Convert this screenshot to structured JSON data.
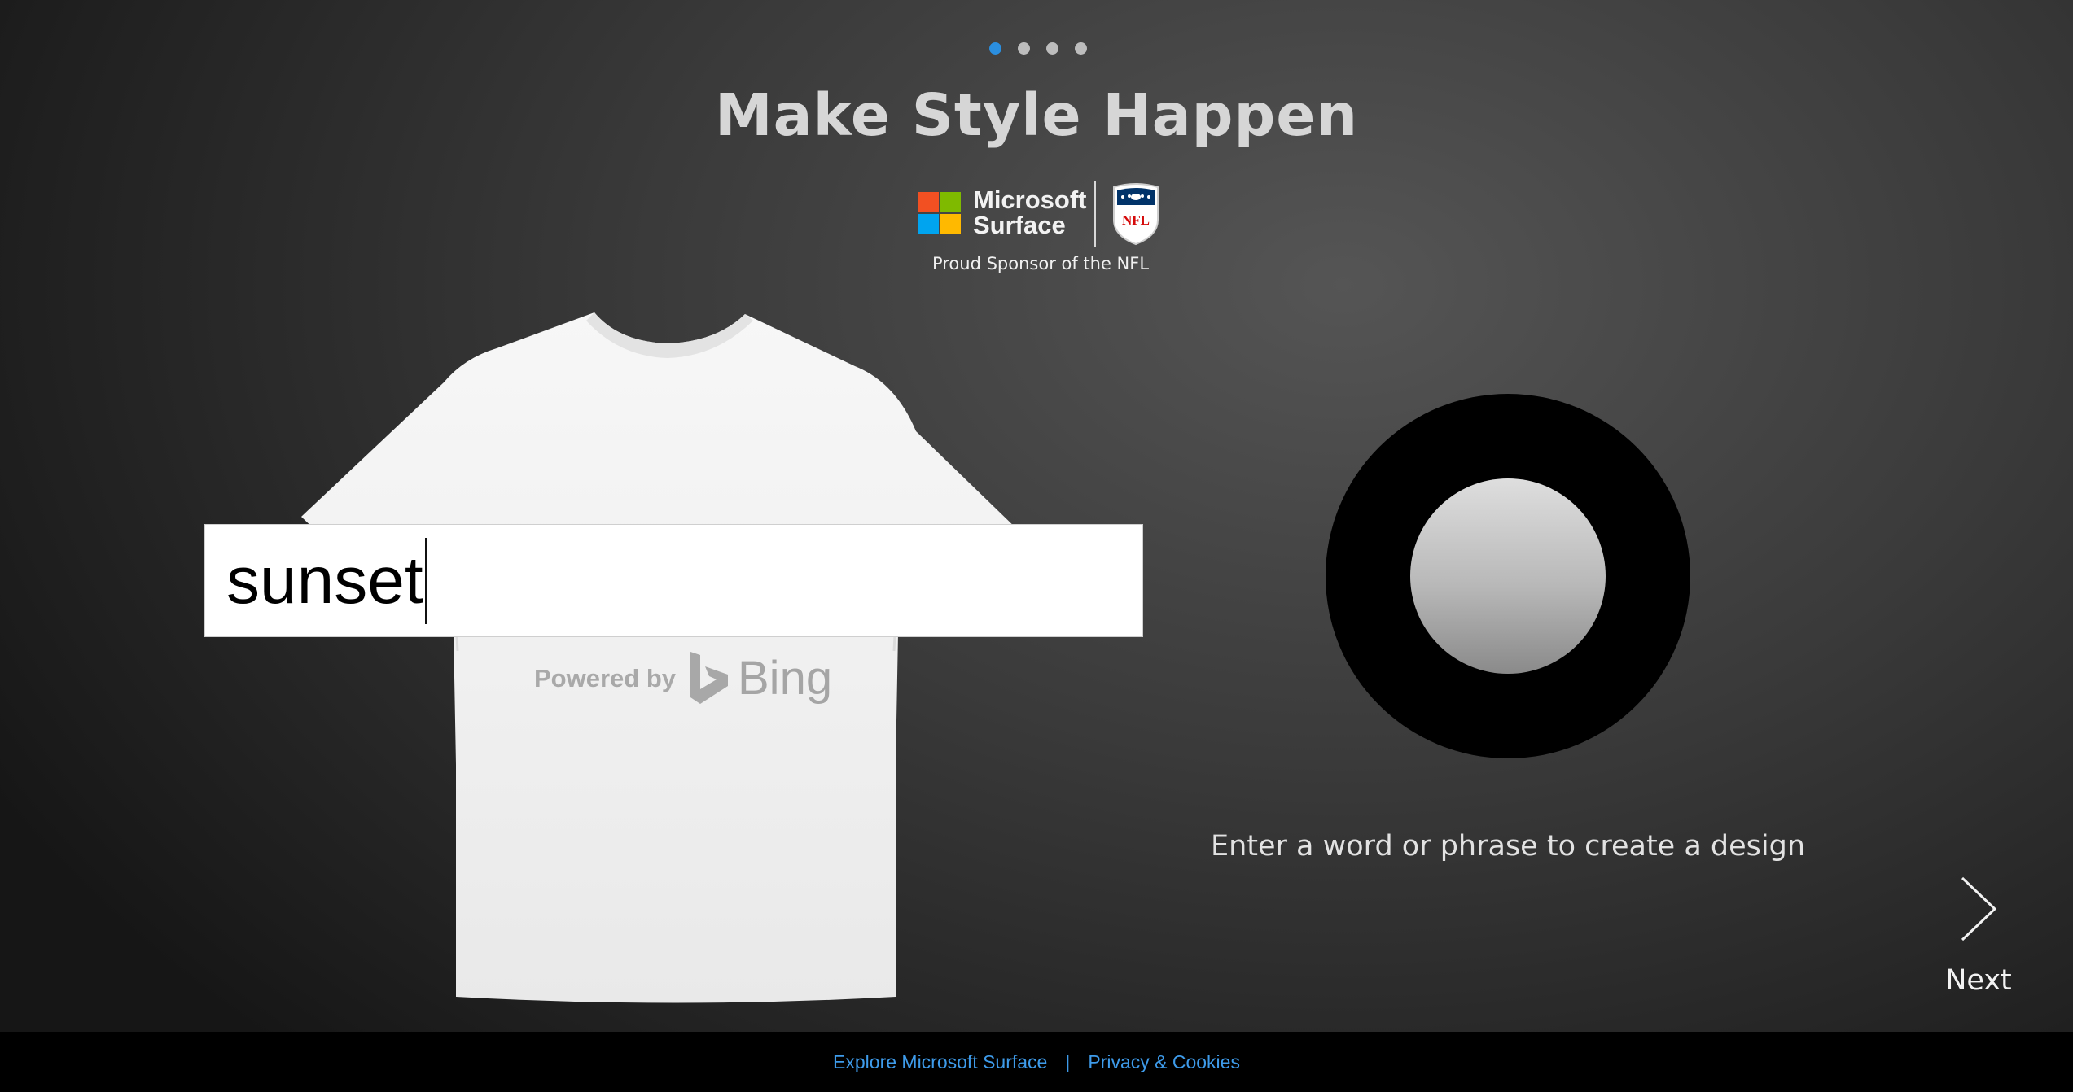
{
  "pager": {
    "count": 4,
    "active_index": 0
  },
  "title": "Make Style Happen",
  "sponsor": {
    "brand_line1": "Microsoft",
    "brand_line2": "Surface",
    "tagline": "Proud Sponsor of the NFL",
    "logo_icon": "nfl-shield-icon"
  },
  "search": {
    "value": "sunset"
  },
  "powered_by": {
    "label": "Powered by",
    "brand": "Bing"
  },
  "record": {
    "icon": "record-button-icon"
  },
  "hint": "Enter a word or phrase to create a design",
  "next": {
    "label": "Next",
    "icon": "chevron-right-icon"
  },
  "footer": {
    "link1": "Explore Microsoft Surface",
    "separator": "|",
    "link2": "Privacy & Cookies"
  },
  "colors": {
    "accent": "#2b8fe0",
    "footer_link": "#3e9bea",
    "ms_red": "#f25022",
    "ms_green": "#7fba00",
    "ms_blue": "#00a4ef",
    "ms_yellow": "#ffb900"
  }
}
